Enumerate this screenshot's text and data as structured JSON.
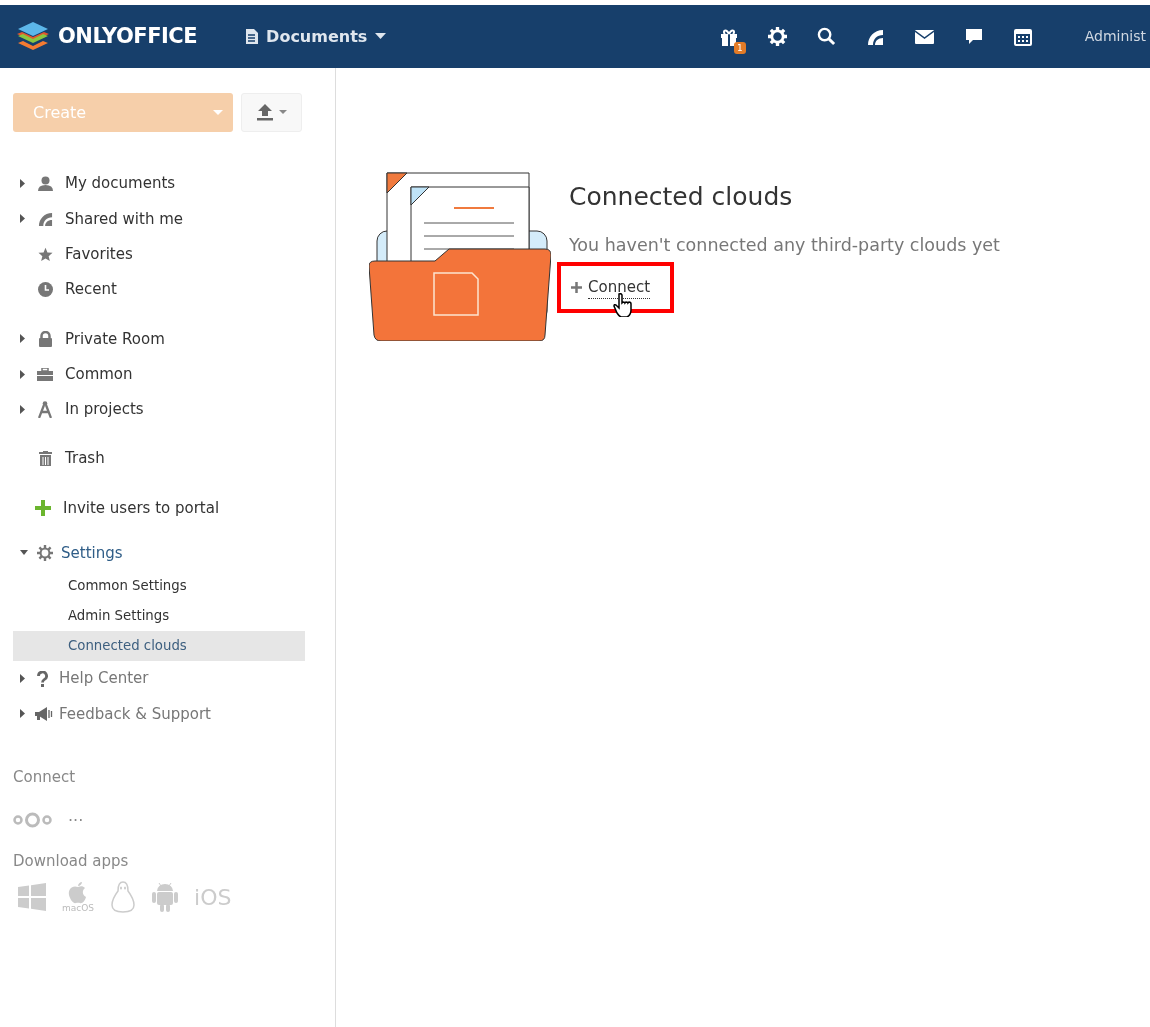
{
  "header": {
    "logo": "ONLYOFFICE",
    "module": "Documents",
    "gift_badge": "1",
    "user": "Administ"
  },
  "toolbar": {
    "create": "Create",
    "create_disabled": true
  },
  "nav_groups": [
    [
      {
        "label": "My documents",
        "kind": "expandable",
        "expanded": false
      },
      {
        "label": "Shared with me",
        "kind": "expandable",
        "expanded": false
      },
      {
        "label": "Favorites",
        "kind": "plain"
      },
      {
        "label": "Recent",
        "kind": "plain"
      }
    ],
    [
      {
        "label": "Private Room",
        "kind": "expandable",
        "expanded": false
      },
      {
        "label": "Common",
        "kind": "expandable",
        "expanded": false
      },
      {
        "label": "In projects",
        "kind": "expandable",
        "expanded": false
      }
    ],
    [
      {
        "label": "Trash",
        "kind": "plain"
      }
    ]
  ],
  "invite": "Invite users to portal",
  "settings": {
    "label": "Settings",
    "expanded": true,
    "children": [
      {
        "label": "Common Settings",
        "selected": false
      },
      {
        "label": "Admin Settings",
        "selected": false
      },
      {
        "label": "Connected clouds",
        "selected": true
      }
    ]
  },
  "help_items": [
    {
      "label": "Help Center",
      "expanded": false
    },
    {
      "label": "Feedback & Support",
      "expanded": false
    }
  ],
  "connect": {
    "title": "Connect",
    "more": "..."
  },
  "download_apps": {
    "title": "Download apps",
    "apps": [
      {
        "kind": "windows"
      },
      {
        "kind": "macos",
        "label": "macOS"
      },
      {
        "kind": "linux"
      },
      {
        "kind": "android"
      },
      {
        "kind": "ios",
        "label": "iOS"
      }
    ]
  },
  "content": {
    "title": "Connected clouds",
    "message": "You haven't connected any third-party clouds yet",
    "action": "Connect"
  }
}
